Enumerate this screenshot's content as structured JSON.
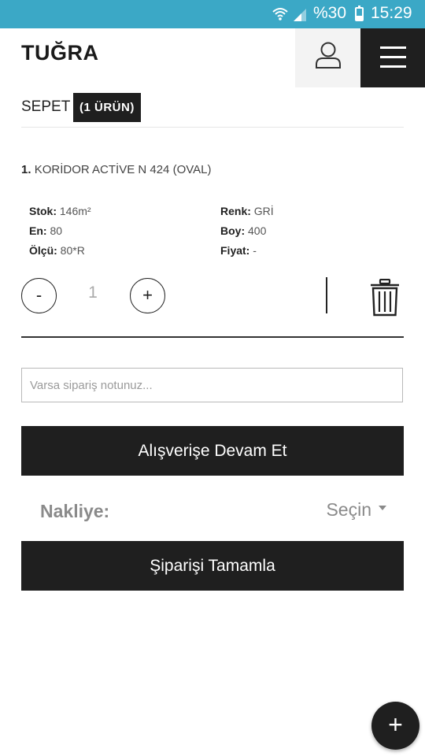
{
  "status_bar": {
    "battery_percent": "%30",
    "time": "15:29",
    "icons": [
      "wifi-icon",
      "signal-icon",
      "battery-icon"
    ]
  },
  "header": {
    "logo": "TUĞRA",
    "icons": [
      "user-icon",
      "hamburger-menu-icon"
    ]
  },
  "cart": {
    "title": "SEPET",
    "count_badge": "(1 ÜRÜN)"
  },
  "product": {
    "index": "1.",
    "name": "KORİDOR ACTİVE N 424 (OVAL)",
    "attributes": {
      "stock_label": "Stok:",
      "stock_value": "146m²",
      "width_label": "En:",
      "width_value": "80",
      "size_label": "Ölçü:",
      "size_value": "80*R",
      "color_label": "Renk:",
      "color_value": "GRİ",
      "length_label": "Boy:",
      "length_value": "400",
      "price_label": "Fiyat:",
      "price_value": "-"
    },
    "quantity": "1",
    "minus_label": "-",
    "plus_label": "+"
  },
  "note": {
    "placeholder": "Varsa sipariş notunuz..."
  },
  "buttons": {
    "continue_shopping": "Alışverişe Devam Et",
    "complete_order": "Şiparişi Tamamla",
    "fab_label": "+"
  },
  "shipping": {
    "label": "Nakliye:",
    "selected": "Seçin"
  },
  "colors": {
    "status_bar": "#3ba8c6",
    "dark": "#1f1f1f",
    "muted_text": "#8a8a8a"
  }
}
